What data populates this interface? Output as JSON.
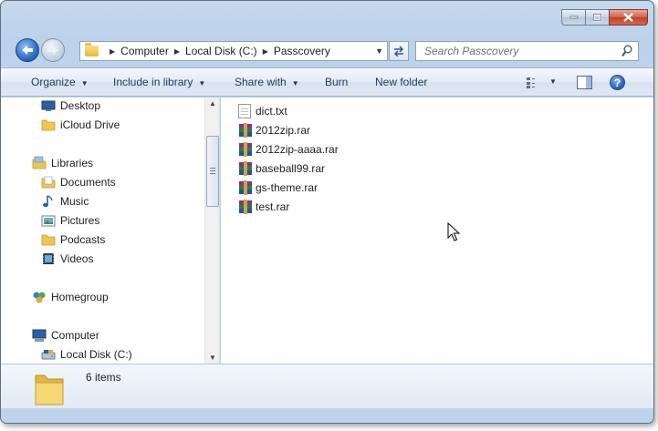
{
  "window": {
    "controls": [
      "minimize",
      "maximize",
      "close"
    ]
  },
  "address": {
    "crumbs": [
      "Computer",
      "Local Disk (C:)",
      "Passcovery"
    ]
  },
  "search": {
    "placeholder": "Search Passcovery"
  },
  "toolbar": {
    "organize": "Organize",
    "include": "Include in library",
    "share": "Share with",
    "burn": "Burn",
    "new_folder": "New folder"
  },
  "nav_tree": {
    "desktop": "Desktop",
    "icloud": "iCloud Drive",
    "libraries": "Libraries",
    "documents": "Documents",
    "music": "Music",
    "pictures": "Pictures",
    "podcasts": "Podcasts",
    "videos": "Videos",
    "homegroup": "Homegroup",
    "computer": "Computer",
    "local_disk": "Local Disk (C:)"
  },
  "files": [
    {
      "name": "dict.txt",
      "type": "text"
    },
    {
      "name": "2012zip.rar",
      "type": "rar"
    },
    {
      "name": "2012zip-aaaa.rar",
      "type": "rar"
    },
    {
      "name": "baseball99.rar",
      "type": "rar"
    },
    {
      "name": "gs-theme.rar",
      "type": "rar"
    },
    {
      "name": "test.rar",
      "type": "rar"
    }
  ],
  "status": {
    "count": "6 items"
  },
  "icons": {
    "back": "back-arrow-icon",
    "forward": "forward-arrow-icon",
    "refresh": "refresh-icon",
    "search": "search-icon",
    "views": "views-icon",
    "preview_pane": "preview-pane-icon",
    "help": "help-icon"
  },
  "colors": {
    "frame": "#bdd3ec",
    "toolbar_text": "#1e395b",
    "close_button": "#c24128"
  }
}
